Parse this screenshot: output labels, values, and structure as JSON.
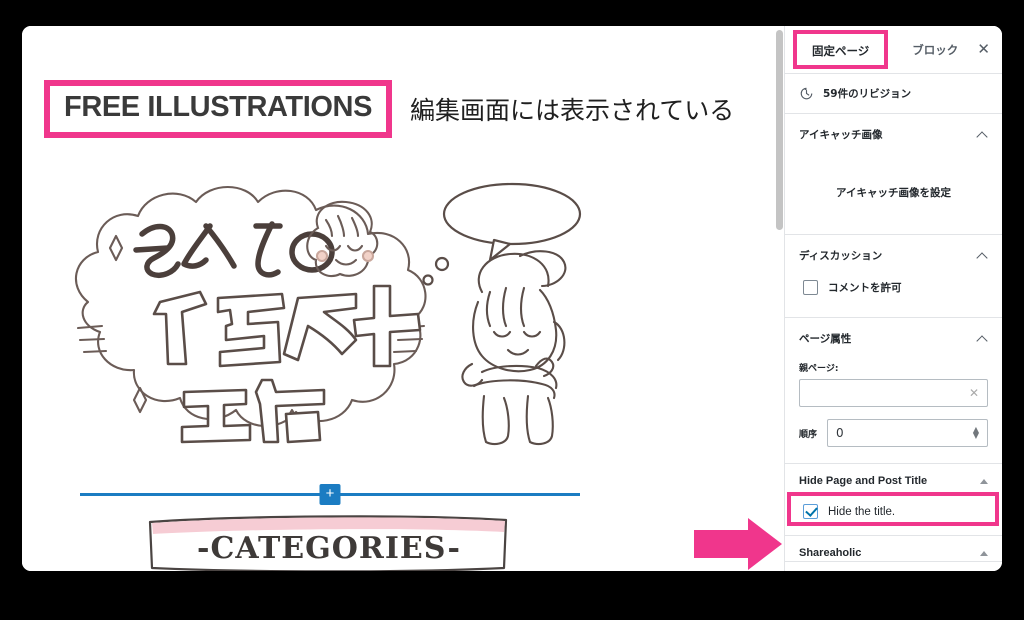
{
  "theme": {
    "accent_pink": "#f0368c",
    "inserter_blue": "#1b7cc2",
    "checkbox_blue": "#0073aa",
    "banner_pink": "#f6ccd4",
    "border_grey": "#e2e4e7"
  },
  "canvas": {
    "post_title": "FREE ILLUSTRATIONS",
    "annotation": "編集画面には表示されている",
    "illustration_alt": "ふくちのイラスト工房",
    "illustration_lines": [
      "ふくちの",
      "イラスト",
      "工房"
    ],
    "inserter_button_label": "+",
    "categories_banner_text": "-CATEGORIES-"
  },
  "sidebar": {
    "tabs": [
      {
        "label": "固定ページ",
        "active": true
      },
      {
        "label": "ブロック",
        "active": false
      }
    ],
    "close_label": "✕",
    "revisions": {
      "label": "59件のリビジョン",
      "icon": "history-icon"
    },
    "panels": [
      {
        "title": "アイキャッチ画像",
        "set_featured_image_label": "アイキャッチ画像を設定"
      },
      {
        "title": "ディスカッション",
        "allow_comments_label": "コメントを許可",
        "allow_comments_checked": false
      },
      {
        "title": "ページ属性",
        "parent_page_label": "親ページ:",
        "parent_page_value": "",
        "parent_page_clear": "✕",
        "order_label": "順序",
        "order_value": "0"
      }
    ],
    "metaboxes": [
      {
        "title": "Hide Page and Post Title",
        "checkbox_label": "Hide the title.",
        "checked": true,
        "highlighted": true
      },
      {
        "title": "Shareaholic",
        "checkbox_label": "",
        "checked": false,
        "highlighted": false
      }
    ]
  },
  "annotations": {
    "arrow": "pink-right-arrow",
    "title_highlight": "pink-rectangle",
    "tab_highlight": "pink-rectangle",
    "hide_title_highlight": "pink-rectangle"
  }
}
